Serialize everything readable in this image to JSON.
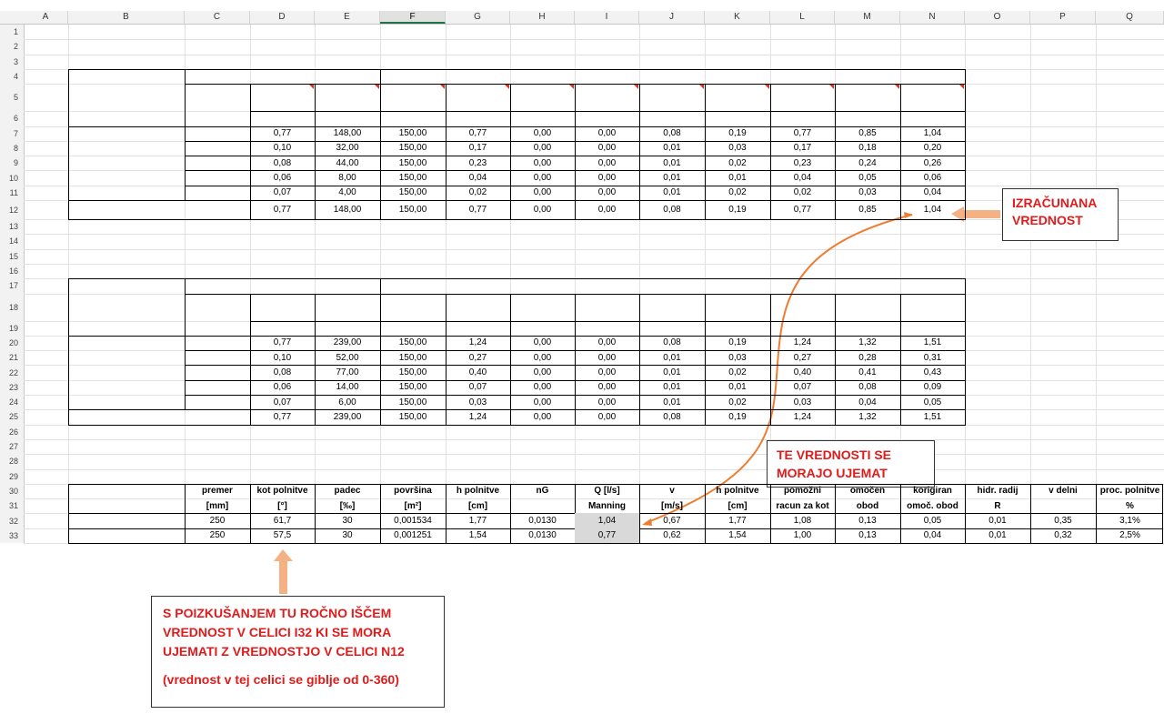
{
  "columns": [
    "A",
    "B",
    "C",
    "D",
    "E",
    "F",
    "G",
    "H",
    "I",
    "J",
    "K",
    "L",
    "M",
    "N",
    "O",
    "P",
    "Q"
  ],
  "selected_column": "F",
  "rows": [
    1,
    2,
    3,
    4,
    5,
    6,
    7,
    8,
    9,
    10,
    11,
    12,
    13,
    14,
    15,
    16,
    17,
    18,
    19,
    20,
    21,
    22,
    23,
    24,
    25,
    26,
    27,
    28,
    29,
    30,
    31,
    32,
    33
  ],
  "table1": {
    "rows": [
      [
        "0,77",
        "148,00",
        "150,00",
        "0,77",
        "0,00",
        "0,00",
        "0,08",
        "0,19",
        "0,77",
        "0,85",
        "1,04"
      ],
      [
        "0,10",
        "32,00",
        "150,00",
        "0,17",
        "0,00",
        "0,00",
        "0,01",
        "0,03",
        "0,17",
        "0,18",
        "0,20"
      ],
      [
        "0,08",
        "44,00",
        "150,00",
        "0,23",
        "0,00",
        "0,00",
        "0,01",
        "0,02",
        "0,23",
        "0,24",
        "0,26"
      ],
      [
        "0,06",
        "8,00",
        "150,00",
        "0,04",
        "0,00",
        "0,00",
        "0,01",
        "0,01",
        "0,04",
        "0,05",
        "0,06"
      ],
      [
        "0,07",
        "4,00",
        "150,00",
        "0,02",
        "0,00",
        "0,00",
        "0,01",
        "0,02",
        "0,02",
        "0,03",
        "0,04"
      ],
      [
        "0,77",
        "148,00",
        "150,00",
        "0,77",
        "0,00",
        "0,00",
        "0,08",
        "0,19",
        "0,77",
        "0,85",
        "1,04"
      ]
    ]
  },
  "table2": {
    "rows": [
      [
        "0,77",
        "239,00",
        "150,00",
        "1,24",
        "0,00",
        "0,00",
        "0,08",
        "0,19",
        "1,24",
        "1,32",
        "1,51"
      ],
      [
        "0,10",
        "52,00",
        "150,00",
        "0,27",
        "0,00",
        "0,00",
        "0,01",
        "0,03",
        "0,27",
        "0,28",
        "0,31"
      ],
      [
        "0,08",
        "77,00",
        "150,00",
        "0,40",
        "0,00",
        "0,00",
        "0,01",
        "0,02",
        "0,40",
        "0,41",
        "0,43"
      ],
      [
        "0,06",
        "14,00",
        "150,00",
        "0,07",
        "0,00",
        "0,00",
        "0,01",
        "0,01",
        "0,07",
        "0,08",
        "0,09"
      ],
      [
        "0,07",
        "6,00",
        "150,00",
        "0,03",
        "0,00",
        "0,00",
        "0,01",
        "0,02",
        "0,03",
        "0,04",
        "0,05"
      ],
      [
        "0,77",
        "239,00",
        "150,00",
        "1,24",
        "0,00",
        "0,00",
        "0,08",
        "0,19",
        "1,24",
        "1,32",
        "1,51"
      ]
    ]
  },
  "table3": {
    "header1": [
      "premer",
      "kot polnitve",
      "padec",
      "površina",
      "h polnitve",
      "nG",
      "Q [l/s]",
      "v",
      "h polnitve",
      "pomožni",
      "omočen",
      "korigiran",
      "hidr. radij",
      "v delni",
      "proc. polnitve"
    ],
    "header2": [
      "[mm]",
      "[°]",
      "[‰]",
      "[m²]",
      "[cm]",
      "",
      "Manning",
      "[m/s]",
      "[cm]",
      "racun za kot",
      "obod",
      "omoč. obod",
      "R",
      "",
      "%"
    ],
    "rows": [
      [
        "250",
        "61,7",
        "30",
        "0,001534",
        "1,77",
        "0,0130",
        "1,04",
        "0,67",
        "1,77",
        "1,08",
        "0,13",
        "0,05",
        "0,01",
        "0,35",
        "3,1%"
      ],
      [
        "250",
        "57,5",
        "30",
        "0,001251",
        "1,54",
        "0,0130",
        "0,77",
        "0,62",
        "1,54",
        "1,00",
        "0,13",
        "0,04",
        "0,01",
        "0,32",
        "2,5%"
      ]
    ]
  },
  "notes": {
    "calculated_line1": "IZRAČUNANA",
    "calculated_line2": "VREDNOST",
    "must_match_line1": "TE VREDNOSTI SE",
    "must_match_line2": "MORAJO UJEMAT",
    "instruction_line1": "S POIZKUŠANJEM TU ROČNO IŠČEM",
    "instruction_line2": "VREDNOST V CELICI I32 KI SE MORA",
    "instruction_line3": "UJEMATI Z VREDNOSTJO V CELICI N12",
    "instruction_line4": "(vrednost v tej celici se giblje od 0-360)"
  },
  "colors": {
    "note_text": "#e01b1b",
    "arrow_fill": "#f4b183",
    "curve": "#ed7d31",
    "highlight_cell": "#d9d9d9",
    "selected_header": "#217346"
  }
}
